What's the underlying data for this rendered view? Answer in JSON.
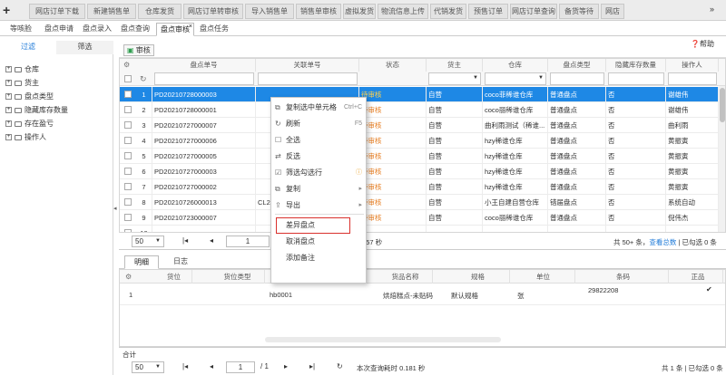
{
  "top_tabs": [
    "网店订单下载",
    "新建销售单",
    "仓库发货",
    "网店订单转审核",
    "导入销售单",
    "销售单审核",
    "虚拟发货",
    "物流信息上传",
    "代销发货",
    "预售订单",
    "网店订单查询",
    "备货等待",
    "网店"
  ],
  "sub_tabs": [
    "等咳脸",
    "盘点申请",
    "盘点录入",
    "盘点查询",
    "盘点审核",
    "盘点任务"
  ],
  "left": {
    "tabs": [
      "过滤",
      "筛选"
    ],
    "tree": [
      "仓库",
      "货主",
      "盘点类型",
      "隐藏库存数量",
      "存在盈亏",
      "操作人"
    ]
  },
  "toolbar": {
    "audit": "审核",
    "help": "帮助"
  },
  "grid": {
    "headers": [
      "盘点单号",
      "关联单号",
      "状态",
      "货主",
      "仓库",
      "盘点类型",
      "隐藏库存数量",
      "操作人"
    ],
    "rows": [
      [
        "1",
        "PD20210728000003",
        "",
        "待审核",
        "自营",
        "coco菲稀谁仓库",
        "普通盘点",
        "否",
        "谢雄伟"
      ],
      [
        "2",
        "PD20210728000001",
        "",
        "待审核",
        "自营",
        "coco丽稀谁仓库",
        "普通盘点",
        "否",
        "谢雄伟"
      ],
      [
        "3",
        "PD20210727000007",
        "",
        "待审核",
        "自营",
        "曲利雨测试（稀谁...",
        "普通盘点",
        "否",
        "曲利雨"
      ],
      [
        "4",
        "PD20210727000006",
        "",
        "待审核",
        "自营",
        "hzy稀谁仓库",
        "普通盘点",
        "否",
        "黄振寅"
      ],
      [
        "5",
        "PD20210727000005",
        "",
        "待审核",
        "自营",
        "hzy稀谁仓库",
        "普通盘点",
        "否",
        "黄振寅"
      ],
      [
        "6",
        "PD20210727000003",
        "",
        "待审核",
        "自营",
        "hzy稀谁仓库",
        "普通盘点",
        "否",
        "黄振寅"
      ],
      [
        "7",
        "PD20210727000002",
        "",
        "待审核",
        "自营",
        "hzy稀谁仓库",
        "普通盘点",
        "否",
        "黄振寅"
      ],
      [
        "8",
        "PD20210726000013",
        "CL20",
        "待审核",
        "自营",
        "小王自建自营仓库",
        "错届盘点",
        "否",
        "系统自动"
      ],
      [
        "9",
        "PD20210723000007",
        "",
        "待审核",
        "自营",
        "coco丽稀谁仓库",
        "普通盘点",
        "否",
        "倪伟杰"
      ],
      [
        "10",
        "",
        "",
        "",
        "",
        "",
        "",
        "",
        ""
      ]
    ]
  },
  "pager": {
    "size": "50",
    "page": "1",
    "time": "257 秒",
    "total": "共 50+ 条，",
    "view_total": "查看总数",
    "selected": "| 已勾选 0 条"
  },
  "context_menu": [
    {
      "label": "复制选中单元格",
      "shortcut": "Ctrl+C",
      "icon": "copy-icon"
    },
    {
      "label": "刷新",
      "shortcut": "F5",
      "icon": "refresh-icon"
    },
    {
      "label": "全选",
      "shortcut": "",
      "icon": "select-all-icon"
    },
    {
      "label": "反选",
      "shortcut": "",
      "icon": "invert-icon"
    },
    {
      "label": "筛选勾选行",
      "shortcut": "",
      "icon": "filter-icon"
    },
    {
      "label": "复制",
      "shortcut": "",
      "icon": "copy-icon"
    },
    {
      "label": "导出",
      "shortcut": "",
      "icon": "export-icon"
    },
    {
      "label": "差异盘点",
      "shortcut": "",
      "icon": ""
    },
    {
      "label": "取消盘点",
      "shortcut": "",
      "icon": ""
    },
    {
      "label": "添加备注",
      "shortcut": "",
      "icon": ""
    }
  ],
  "detail": {
    "tabs": [
      "明细",
      "日志"
    ],
    "headers": [
      "货位",
      "货位类型",
      "",
      "货品名称",
      "规格",
      "单位",
      "条码",
      "正品"
    ],
    "row": {
      "no": "1",
      "code": "hb0001",
      "name": "烘焙糕点-未贴码",
      "spec": "默认规格",
      "unit": "张",
      "barcode": "29822208"
    },
    "total_label": "合计",
    "pager": {
      "size": "50",
      "page": "1",
      "pages": "/ 1",
      "time": "本次查询耗时 0.181 秒",
      "total": "共 1 条",
      "selected": "| 已勾选 0 条"
    }
  },
  "colors": {
    "accent": "#1e7ad8",
    "selected_row": "#1e88e5",
    "status": "#e67e22",
    "highlight_box": "#d9302c"
  }
}
